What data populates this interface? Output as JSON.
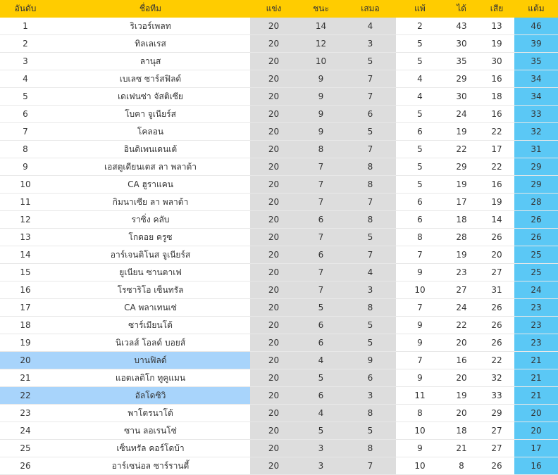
{
  "table": {
    "headers": {
      "rank": "อันดับ",
      "team": "ชื่อทีม",
      "played": "แข่ง",
      "won": "ชนะ",
      "drawn": "เสมอ",
      "lost": "แพ้",
      "goals_for": "ได้",
      "goals_against": "เสีย",
      "points": "แต้ม"
    },
    "colors": {
      "header": "#FFCC00",
      "stats_cell": "#DDDDDD",
      "points_cell": "#5BC8F5",
      "highlight_row": "#A8D4FB"
    },
    "highlighted_ranks": [
      "20",
      "22"
    ],
    "rows": [
      {
        "rank": "1",
        "team": "ริเวอร์เพลท",
        "played": "20",
        "won": "14",
        "drawn": "4",
        "lost": "2",
        "goals_for": "43",
        "goals_against": "13",
        "points": "46"
      },
      {
        "rank": "2",
        "team": "ทิลเลเรส",
        "played": "20",
        "won": "12",
        "drawn": "3",
        "lost": "5",
        "goals_for": "30",
        "goals_against": "19",
        "points": "39"
      },
      {
        "rank": "3",
        "team": "ลานุส",
        "played": "20",
        "won": "10",
        "drawn": "5",
        "lost": "5",
        "goals_for": "35",
        "goals_against": "30",
        "points": "35"
      },
      {
        "rank": "4",
        "team": "เบเลซ ซาร์สฟิลด์",
        "played": "20",
        "won": "9",
        "drawn": "7",
        "lost": "4",
        "goals_for": "29",
        "goals_against": "16",
        "points": "34"
      },
      {
        "rank": "5",
        "team": "เดเฟนซ่า จัสติเซีย",
        "played": "20",
        "won": "9",
        "drawn": "7",
        "lost": "4",
        "goals_for": "30",
        "goals_against": "18",
        "points": "34"
      },
      {
        "rank": "6",
        "team": "โบคา จูเนียร์ส",
        "played": "20",
        "won": "9",
        "drawn": "6",
        "lost": "5",
        "goals_for": "24",
        "goals_against": "16",
        "points": "33"
      },
      {
        "rank": "7",
        "team": "โคลอน",
        "played": "20",
        "won": "9",
        "drawn": "5",
        "lost": "6",
        "goals_for": "19",
        "goals_against": "22",
        "points": "32"
      },
      {
        "rank": "8",
        "team": "อินดิเพนเดนเต้",
        "played": "20",
        "won": "8",
        "drawn": "7",
        "lost": "5",
        "goals_for": "22",
        "goals_against": "17",
        "points": "31"
      },
      {
        "rank": "9",
        "team": "เอสตูเดียนเตส ลา พลาต้า",
        "played": "20",
        "won": "7",
        "drawn": "8",
        "lost": "5",
        "goals_for": "29",
        "goals_against": "22",
        "points": "29"
      },
      {
        "rank": "10",
        "team": "CA ฮูราแคน",
        "played": "20",
        "won": "7",
        "drawn": "8",
        "lost": "5",
        "goals_for": "19",
        "goals_against": "16",
        "points": "29"
      },
      {
        "rank": "11",
        "team": "กิมนาเซีย ลา พลาต้า",
        "played": "20",
        "won": "7",
        "drawn": "7",
        "lost": "6",
        "goals_for": "17",
        "goals_against": "19",
        "points": "28"
      },
      {
        "rank": "12",
        "team": "ราซิ่ง คลับ",
        "played": "20",
        "won": "6",
        "drawn": "8",
        "lost": "6",
        "goals_for": "18",
        "goals_against": "14",
        "points": "26"
      },
      {
        "rank": "13",
        "team": "โกดอย ครูซ",
        "played": "20",
        "won": "7",
        "drawn": "5",
        "lost": "8",
        "goals_for": "28",
        "goals_against": "26",
        "points": "26"
      },
      {
        "rank": "14",
        "team": "อาร์เจนติโนส จูเนียร์ส",
        "played": "20",
        "won": "6",
        "drawn": "7",
        "lost": "7",
        "goals_for": "19",
        "goals_against": "20",
        "points": "25"
      },
      {
        "rank": "15",
        "team": "ยูเนียน ซานตาเฟ",
        "played": "20",
        "won": "7",
        "drawn": "4",
        "lost": "9",
        "goals_for": "23",
        "goals_against": "27",
        "points": "25"
      },
      {
        "rank": "16",
        "team": "โรซาริโอ เซ็นทรัล",
        "played": "20",
        "won": "7",
        "drawn": "3",
        "lost": "10",
        "goals_for": "27",
        "goals_against": "31",
        "points": "24"
      },
      {
        "rank": "17",
        "team": "CA พลาเทนเซ่",
        "played": "20",
        "won": "5",
        "drawn": "8",
        "lost": "7",
        "goals_for": "24",
        "goals_against": "26",
        "points": "23"
      },
      {
        "rank": "18",
        "team": "ซาร์เมียนโต้",
        "played": "20",
        "won": "6",
        "drawn": "5",
        "lost": "9",
        "goals_for": "22",
        "goals_against": "26",
        "points": "23"
      },
      {
        "rank": "19",
        "team": "นิเวลส์ โอลด์ บอยส์",
        "played": "20",
        "won": "6",
        "drawn": "5",
        "lost": "9",
        "goals_for": "20",
        "goals_against": "26",
        "points": "23"
      },
      {
        "rank": "20",
        "team": "บานฟิลด์",
        "played": "20",
        "won": "4",
        "drawn": "9",
        "lost": "7",
        "goals_for": "16",
        "goals_against": "22",
        "points": "21"
      },
      {
        "rank": "21",
        "team": "แอตเลติโก ทูคูแมน",
        "played": "20",
        "won": "5",
        "drawn": "6",
        "lost": "9",
        "goals_for": "20",
        "goals_against": "32",
        "points": "21"
      },
      {
        "rank": "22",
        "team": "อัลโดซิวิ",
        "played": "20",
        "won": "6",
        "drawn": "3",
        "lost": "11",
        "goals_for": "19",
        "goals_against": "33",
        "points": "21"
      },
      {
        "rank": "23",
        "team": "พาโตรนาโต้",
        "played": "20",
        "won": "4",
        "drawn": "8",
        "lost": "8",
        "goals_for": "20",
        "goals_against": "29",
        "points": "20"
      },
      {
        "rank": "24",
        "team": "ซาน ลอเรนโซ่",
        "played": "20",
        "won": "5",
        "drawn": "5",
        "lost": "10",
        "goals_for": "18",
        "goals_against": "27",
        "points": "20"
      },
      {
        "rank": "25",
        "team": "เซ็นทรัล คอร์โดบ้า",
        "played": "20",
        "won": "3",
        "drawn": "8",
        "lost": "9",
        "goals_for": "21",
        "goals_against": "27",
        "points": "17"
      },
      {
        "rank": "26",
        "team": "อาร์เซน่อล ซาร์รานดี้",
        "played": "20",
        "won": "3",
        "drawn": "7",
        "lost": "10",
        "goals_for": "8",
        "goals_against": "26",
        "points": "16"
      }
    ]
  }
}
